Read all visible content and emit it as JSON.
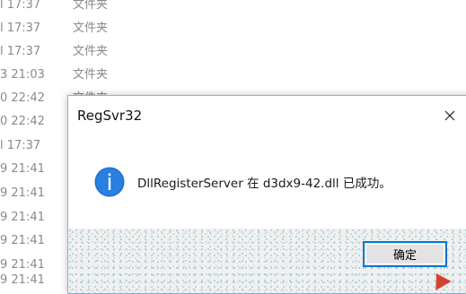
{
  "explorer": {
    "rows": [
      {
        "date": "l 17:37",
        "type": "文件夹"
      },
      {
        "date": "l 17:37",
        "type": "文件夹"
      },
      {
        "date": "l 17:37",
        "type": "文件夹"
      },
      {
        "date": "3 21:03",
        "type": "文件夹"
      },
      {
        "date": "0 22:42",
        "type": "文件夹"
      },
      {
        "date": "0 22:42",
        "type": ""
      },
      {
        "date": "l 17:37",
        "type": ""
      },
      {
        "date": "9 21:41",
        "type": ""
      },
      {
        "date": "9 21:41",
        "type": ""
      },
      {
        "date": "9 21:41",
        "type": ""
      },
      {
        "date": "9 21:41",
        "type": ""
      },
      {
        "date": "9 21:41",
        "type": ""
      },
      {
        "date": "9 21:41",
        "type": ""
      }
    ]
  },
  "dialog": {
    "title": "RegSvr32",
    "message": "DllRegisterServer 在 d3dx9-42.dll 已成功。",
    "ok_label": "确定",
    "icon": "info-icon",
    "close_icon": "close-icon",
    "accent_color": "#0078d7"
  }
}
